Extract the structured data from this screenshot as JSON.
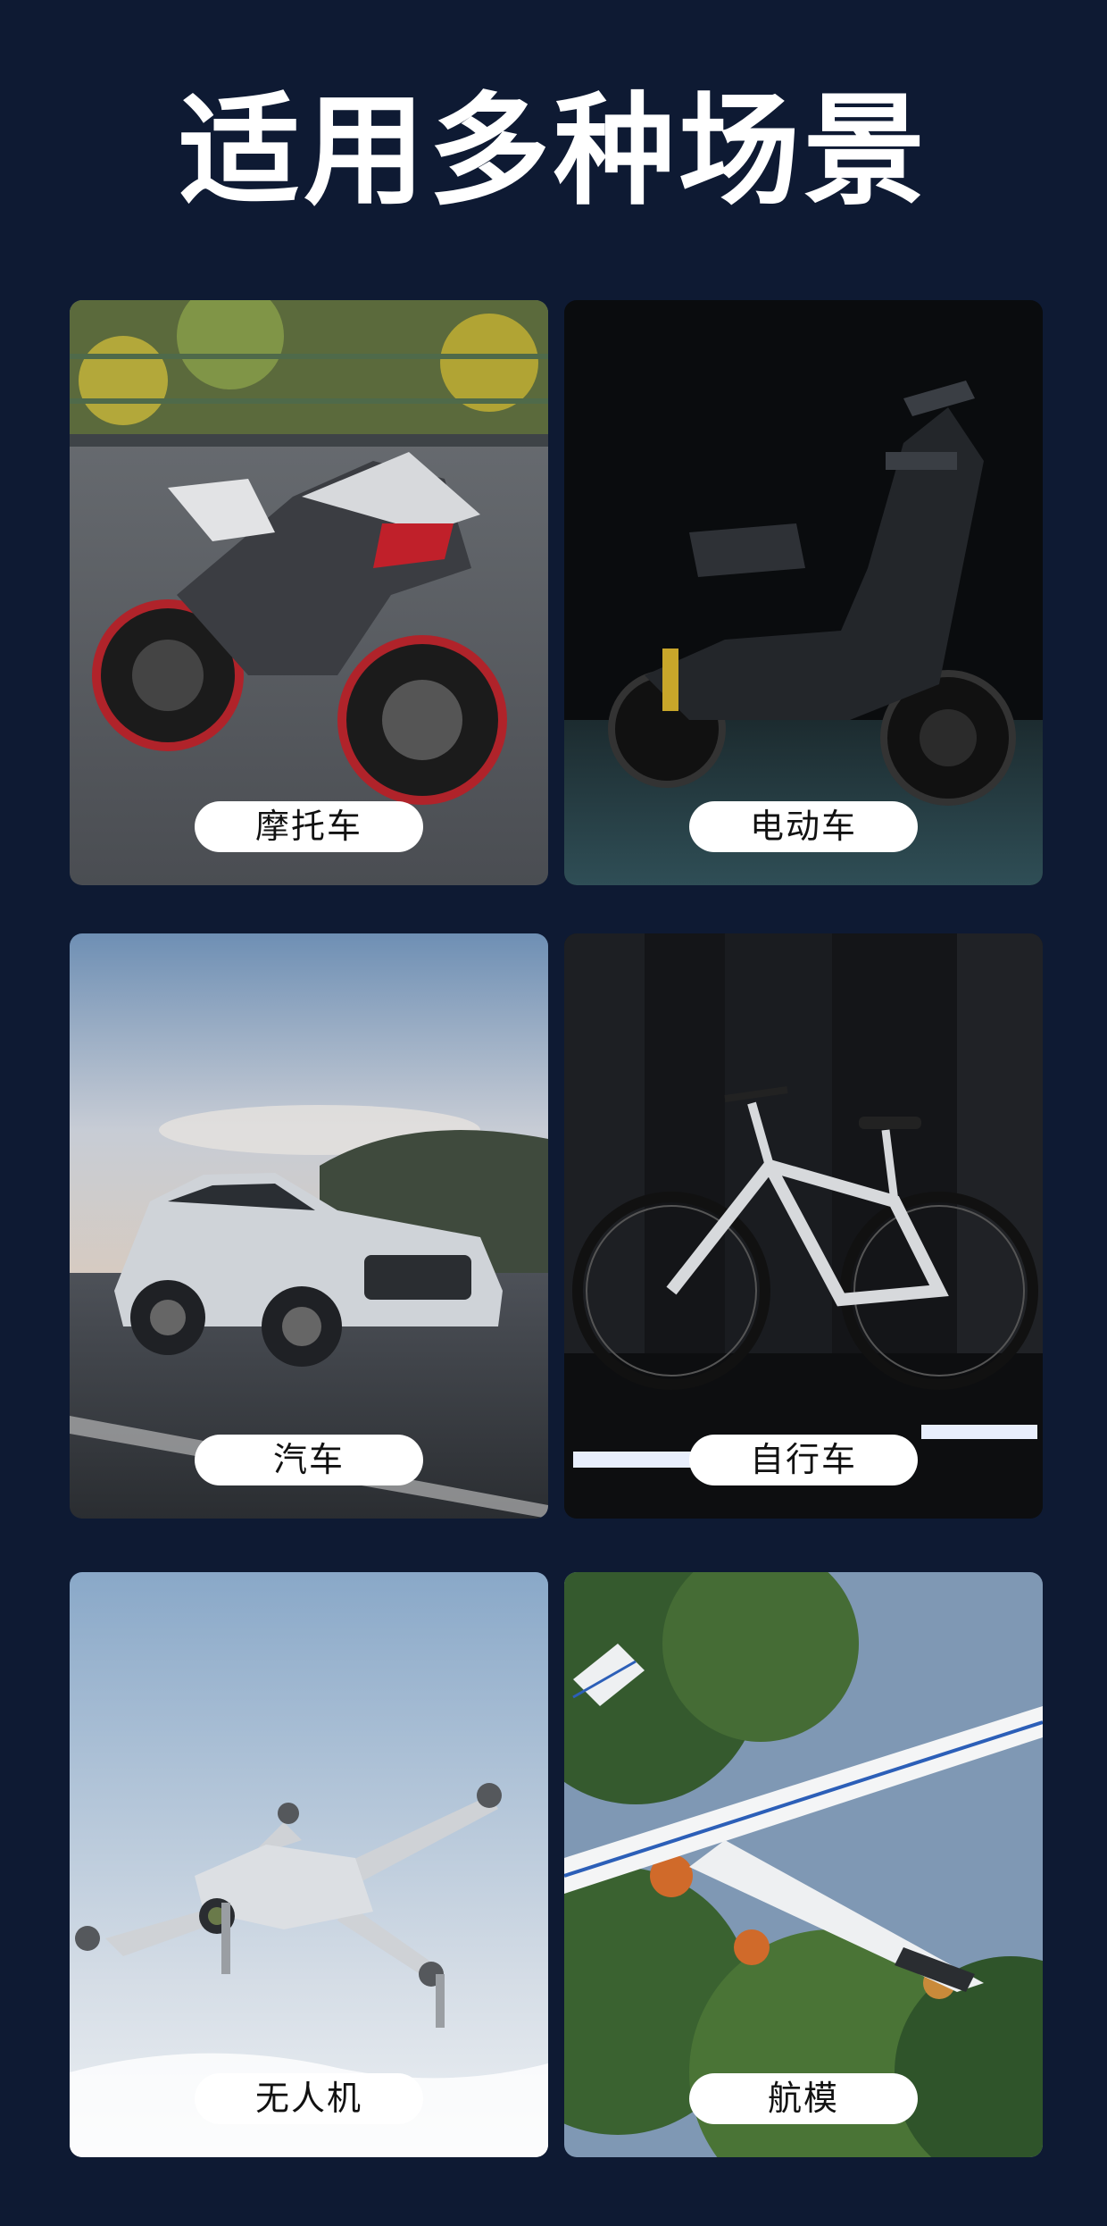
{
  "page": {
    "title": "适用多种场景",
    "background": "#0e1a33"
  },
  "scenes": [
    {
      "label": "摩托车",
      "icon": "motorcycle-image"
    },
    {
      "label": "电动车",
      "icon": "electric-scooter-image"
    },
    {
      "label": "汽车",
      "icon": "car-image"
    },
    {
      "label": "自行车",
      "icon": "bicycle-image"
    },
    {
      "label": "无人机",
      "icon": "drone-image"
    },
    {
      "label": "航模",
      "icon": "model-airplane-image"
    }
  ]
}
